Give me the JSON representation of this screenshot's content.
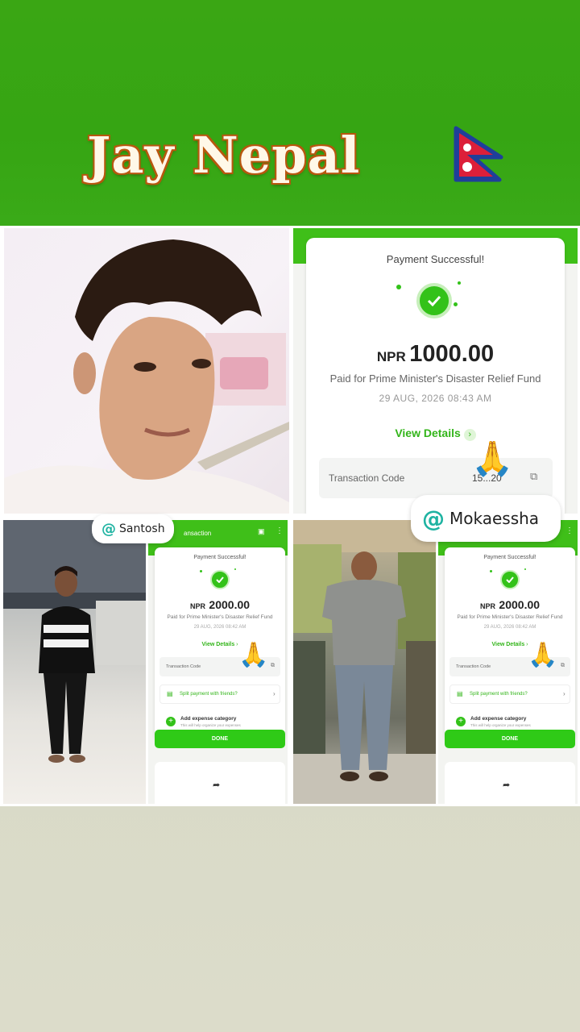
{
  "banner": {
    "title": "Jay Nepal",
    "flag_icon": "nepal-flag-icon",
    "bg_color": "#3aa614"
  },
  "payment_main": {
    "status": "Payment Successful!",
    "currency": "NPR",
    "amount": "1000.00",
    "paid_for": "Paid for Prime Minister's Disaster Relief Fund",
    "datetime": "29 AUG, 2026 08:43 AM",
    "view_details": "View Details",
    "txn_label": "Transaction Code",
    "txn_code": "15...20"
  },
  "payment_small_1": {
    "header_title": "ansaction",
    "status": "Payment Successful!",
    "currency": "NPR",
    "amount": "2000.00",
    "paid_for": "Paid for Prime Minister's Disaster Relief Fund",
    "datetime": "29 AUG, 2026 08:42 AM",
    "view_details": "View Details",
    "txn_label": "Transaction Code",
    "split_label": "Split payment with friends?",
    "expense_title": "Add expense category",
    "expense_sub": "This will help organize your expenses",
    "done_label": "DONE"
  },
  "payment_small_2": {
    "status": "Payment Successful!",
    "currency": "NPR",
    "amount": "2000.00",
    "paid_for": "Paid for Prime Minister's Disaster Relief Fund",
    "datetime": "29 AUG, 2026 08:42 AM",
    "view_details": "View Details",
    "txn_label": "Transaction Code",
    "split_label": "Split payment with friends?",
    "expense_title": "Add expense category",
    "expense_sub": "This will help organize your expenses",
    "done_label": "DONE"
  },
  "tags": {
    "santosh": "Santosh",
    "mokaessha": "Mokaessha"
  },
  "emoji": "🙏",
  "accent": "#33c219"
}
